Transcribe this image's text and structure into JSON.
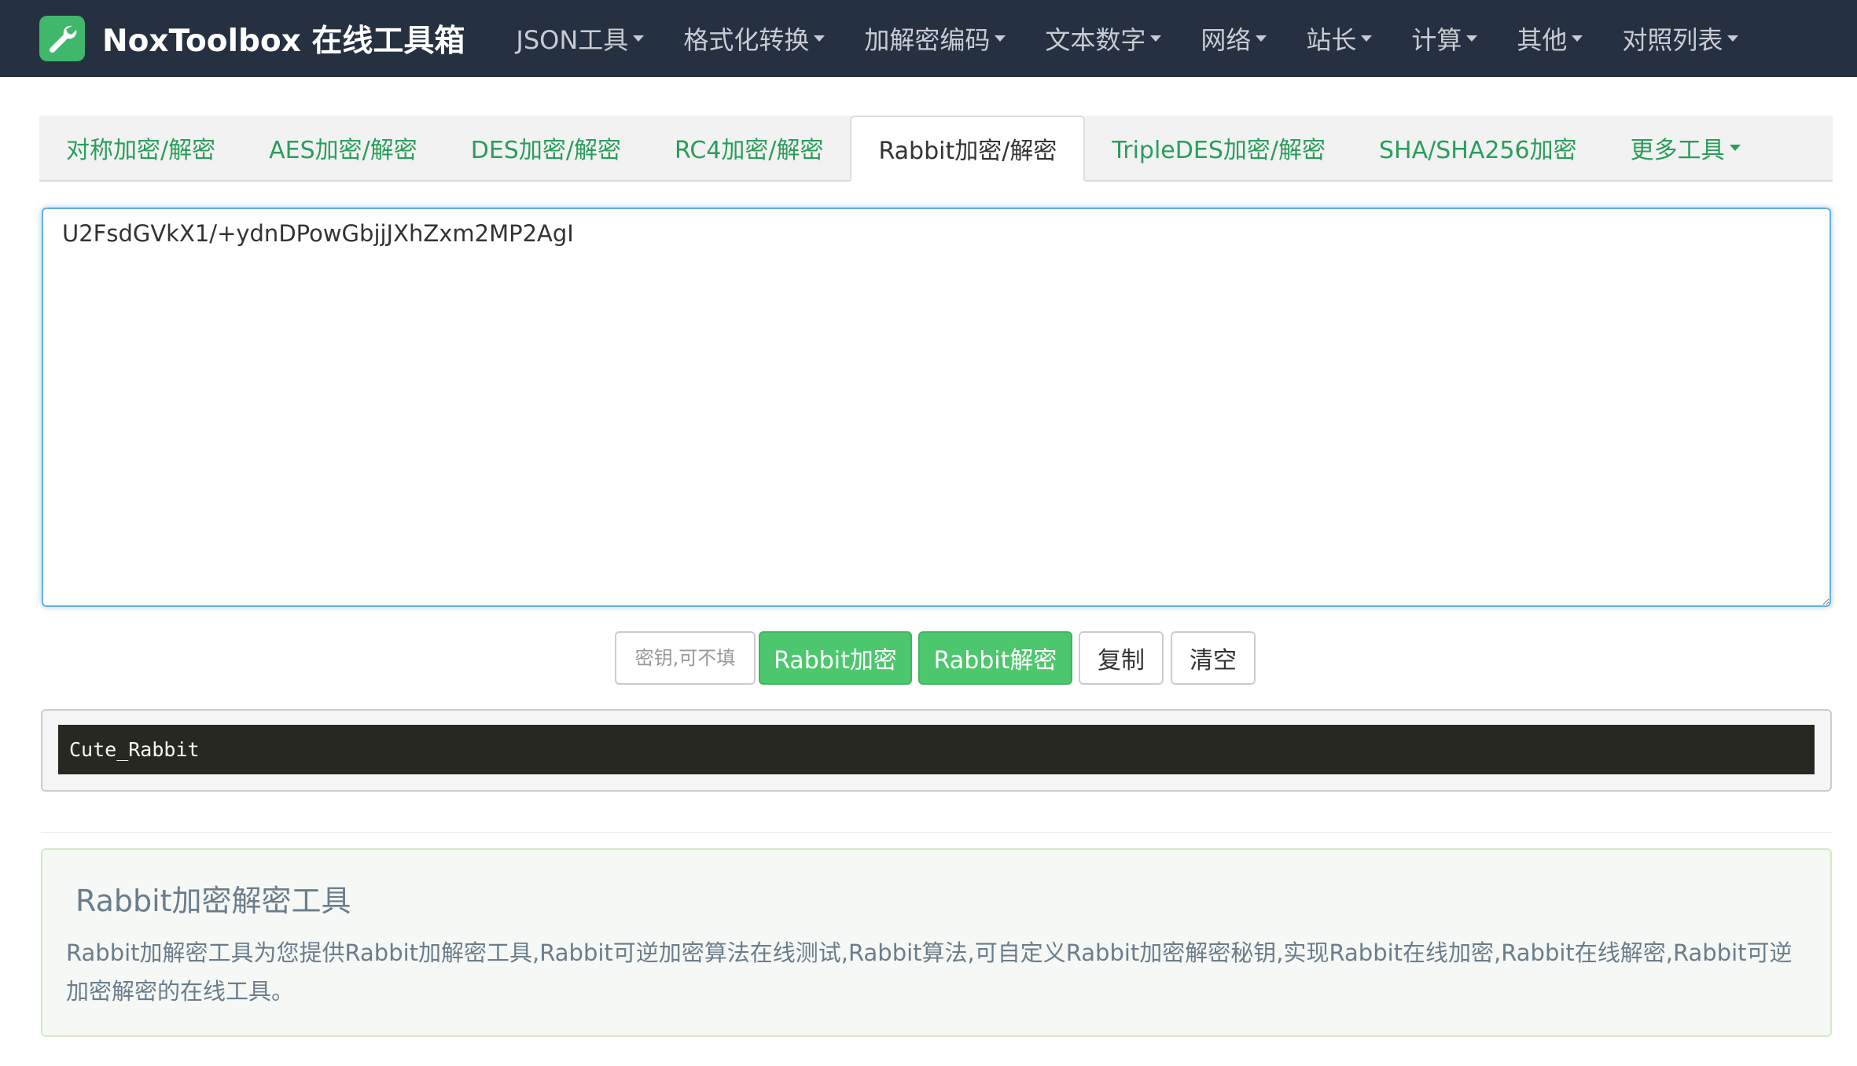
{
  "brand": {
    "name": "NoxToolbox 在线工具箱"
  },
  "nav": [
    {
      "label": "JSON工具"
    },
    {
      "label": "格式化转换"
    },
    {
      "label": "加解密编码"
    },
    {
      "label": "文本数字"
    },
    {
      "label": "网络"
    },
    {
      "label": "站长"
    },
    {
      "label": "计算"
    },
    {
      "label": "其他"
    },
    {
      "label": "对照列表"
    }
  ],
  "tabs": [
    {
      "label": "对称加密/解密",
      "active": false
    },
    {
      "label": "AES加密/解密",
      "active": false
    },
    {
      "label": "DES加密/解密",
      "active": false
    },
    {
      "label": "RC4加密/解密",
      "active": false
    },
    {
      "label": "Rabbit加密/解密",
      "active": true
    },
    {
      "label": "TripleDES加密/解密",
      "active": false
    },
    {
      "label": "SHA/SHA256加密",
      "active": false
    },
    {
      "label": "更多工具",
      "active": false
    }
  ],
  "input": {
    "value": "U2FsdGVkX1/+ydnDPowGbjjJXhZxm2MP2AgI"
  },
  "key": {
    "placeholder": "密钥,可不填"
  },
  "buttons": {
    "encrypt": "Rabbit加密",
    "decrypt": "Rabbit解密",
    "copy": "复制",
    "clear": "清空"
  },
  "result": {
    "text": "Cute_Rabbit"
  },
  "info": {
    "title": "Rabbit加密解密工具",
    "text": "Rabbit加解密工具为您提供Rabbit加解密工具,Rabbit可逆加密算法在线测试,Rabbit算法,可自定义Rabbit加密解密秘钥,实现Rabbit在线加密,Rabbit在线解密,Rabbit可逆加密解密的在线工具。"
  },
  "colors": {
    "navbar_bg": "#253040",
    "accent_green": "#4dc76e",
    "tab_link": "#2a9d5c"
  }
}
